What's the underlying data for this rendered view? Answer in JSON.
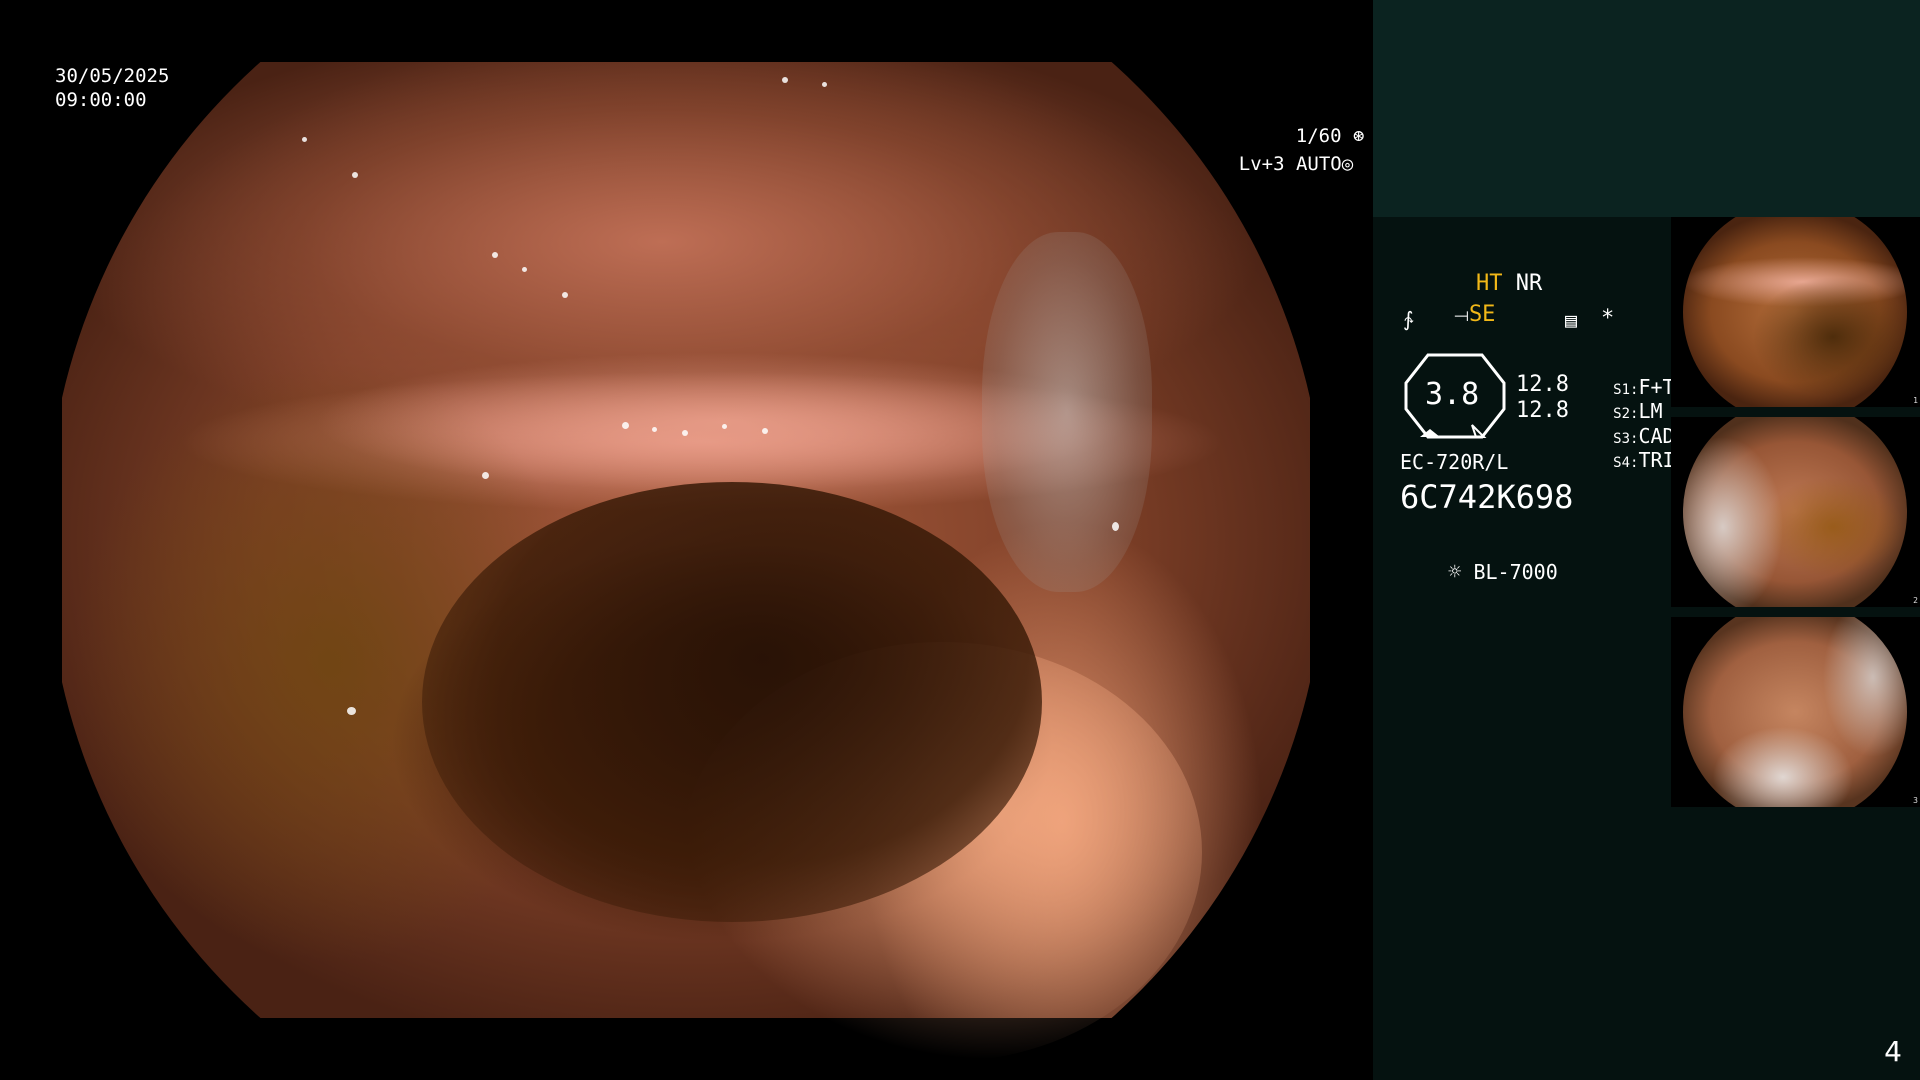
{
  "osd": {
    "date": "30/05/2025",
    "time": "09:00:00",
    "shutter": "1/60",
    "level": "Lv+3 AUTO"
  },
  "settings": {
    "ht": "HT",
    "nr": "NR",
    "se": "SE",
    "gauge_value": "3.8",
    "val_top": "12.8",
    "val_bottom": "12.8",
    "s1_key": "S1:",
    "s1_val": "F+T",
    "s2_key": "S2:",
    "s2_val": "LM",
    "s3_key": "S3:",
    "s3_val": "CAD",
    "s4_key": "S4:",
    "s4_val": "TRIG",
    "scope_model": "EC-720R/L",
    "serial": "6C742K698",
    "light_source": "BL-7000"
  },
  "thumbnails": [
    {
      "index": "1"
    },
    {
      "index": "2"
    },
    {
      "index": "3"
    }
  ],
  "page_number": "4",
  "colors": {
    "accent_yellow": "#f2b818",
    "panel_top": "#0b2320",
    "panel_bottom": "#051210"
  }
}
